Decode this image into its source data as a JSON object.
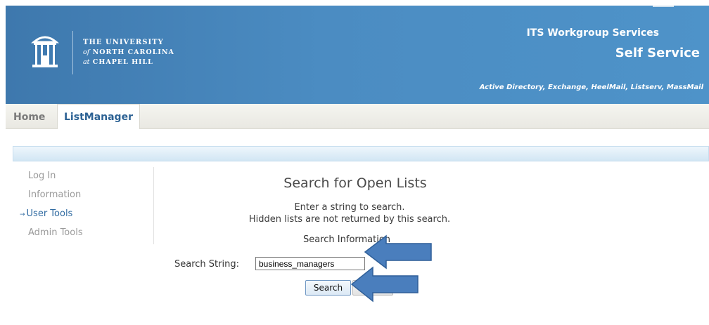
{
  "header": {
    "university_line1": "THE UNIVERSITY",
    "university_line2_em": "of",
    "university_line2": "NORTH CAROLINA",
    "university_line3_em": "at",
    "university_line3": "CHAPEL HILL",
    "service_title": "ITS Workgroup Services",
    "service_subtitle": "Self Service",
    "service_products": "Active Directory, Exchange, HeelMail, Listserv, MassMail",
    "logo_icon": "old-well-icon",
    "banner_color": "#4a89c0"
  },
  "tabs": [
    {
      "label": "Home",
      "active": false
    },
    {
      "label": "ListManager",
      "active": true
    }
  ],
  "sidebar": {
    "items": [
      {
        "label": "Log In",
        "current": false
      },
      {
        "label": "Information",
        "current": false
      },
      {
        "label": "User Tools",
        "current": true
      },
      {
        "label": "Admin Tools",
        "current": false
      }
    ],
    "current_marker": "→"
  },
  "main": {
    "title": "Search for Open Lists",
    "instruction_1": "Enter a string to search.",
    "instruction_2": "Hidden lists are not returned by this search.",
    "section_label": "Search Information",
    "field_label": "Search String:",
    "field_value": "business_managers",
    "search_button": "Search"
  },
  "annotations": {
    "arrow_color": "#4a7ebd",
    "arrow_icon": "callout-arrow-icon"
  }
}
